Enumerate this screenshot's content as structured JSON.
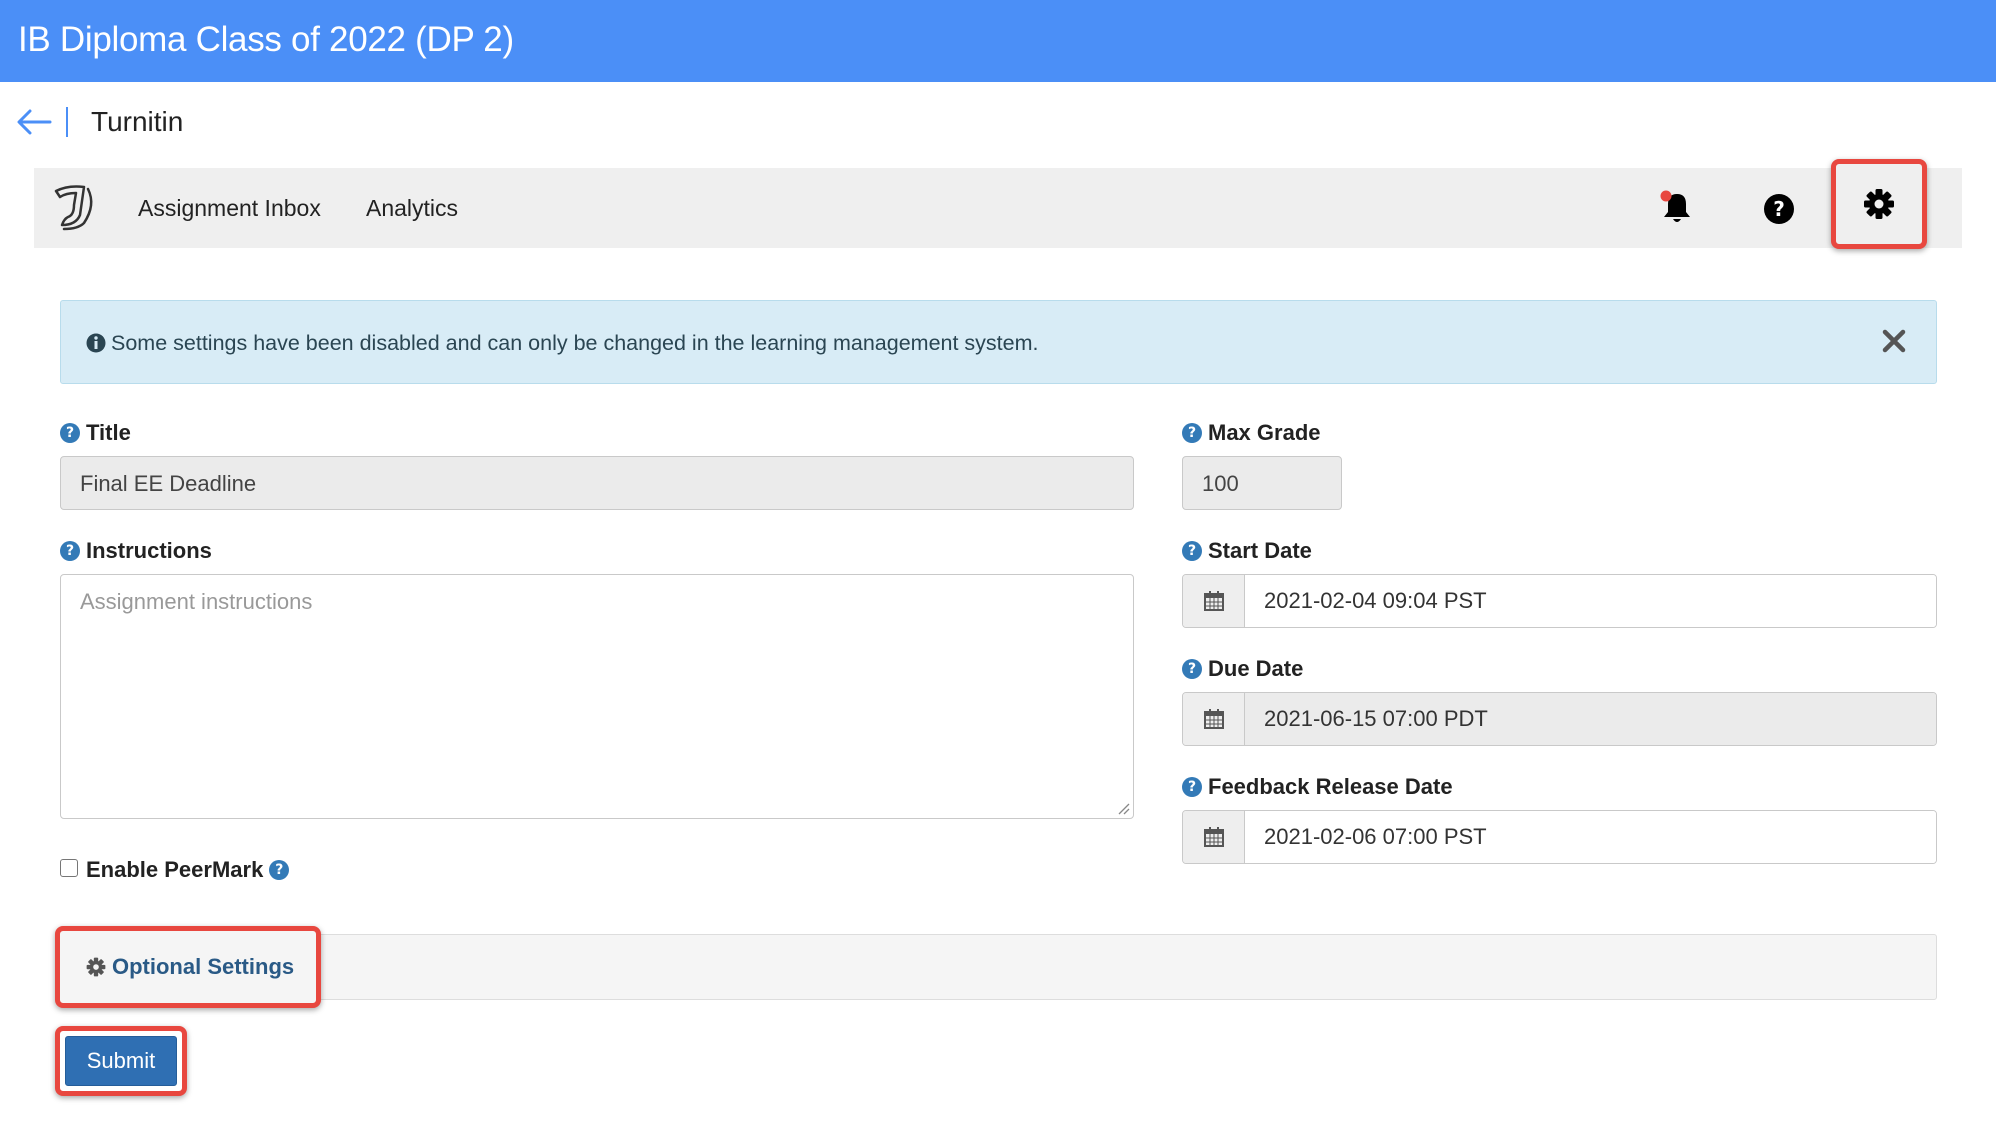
{
  "header": {
    "title": "IB Diploma Class of 2022 (DP 2)"
  },
  "breadcrumb": {
    "tool_name": "Turnitin"
  },
  "nav": {
    "links": [
      {
        "label": "Assignment Inbox"
      },
      {
        "label": "Analytics"
      }
    ],
    "icons": [
      "bell-icon",
      "help-icon",
      "gear-icon"
    ]
  },
  "alert": {
    "message": "Some settings have been disabled and can only be changed in the learning management system."
  },
  "form": {
    "title": {
      "label": "Title",
      "value": "Final EE Deadline"
    },
    "instructions": {
      "label": "Instructions",
      "placeholder": "Assignment instructions"
    },
    "max_grade": {
      "label": "Max Grade",
      "value": "100"
    },
    "start_date": {
      "label": "Start Date",
      "value": "2021-02-04 09:04 PST"
    },
    "due_date": {
      "label": "Due Date",
      "value": "2021-06-15 07:00 PDT"
    },
    "feedback_date": {
      "label": "Feedback Release Date",
      "value": "2021-02-06 07:00 PST"
    },
    "peermark": {
      "label": "Enable PeerMark",
      "checked": false
    }
  },
  "optional_settings": {
    "label": "Optional Settings"
  },
  "submit": {
    "label": "Submit"
  },
  "colors": {
    "header_blue": "#4b8ff7",
    "highlight_red": "#e8473f",
    "primary_button": "#2f6fb3",
    "info_bg": "#d8ecf6"
  }
}
